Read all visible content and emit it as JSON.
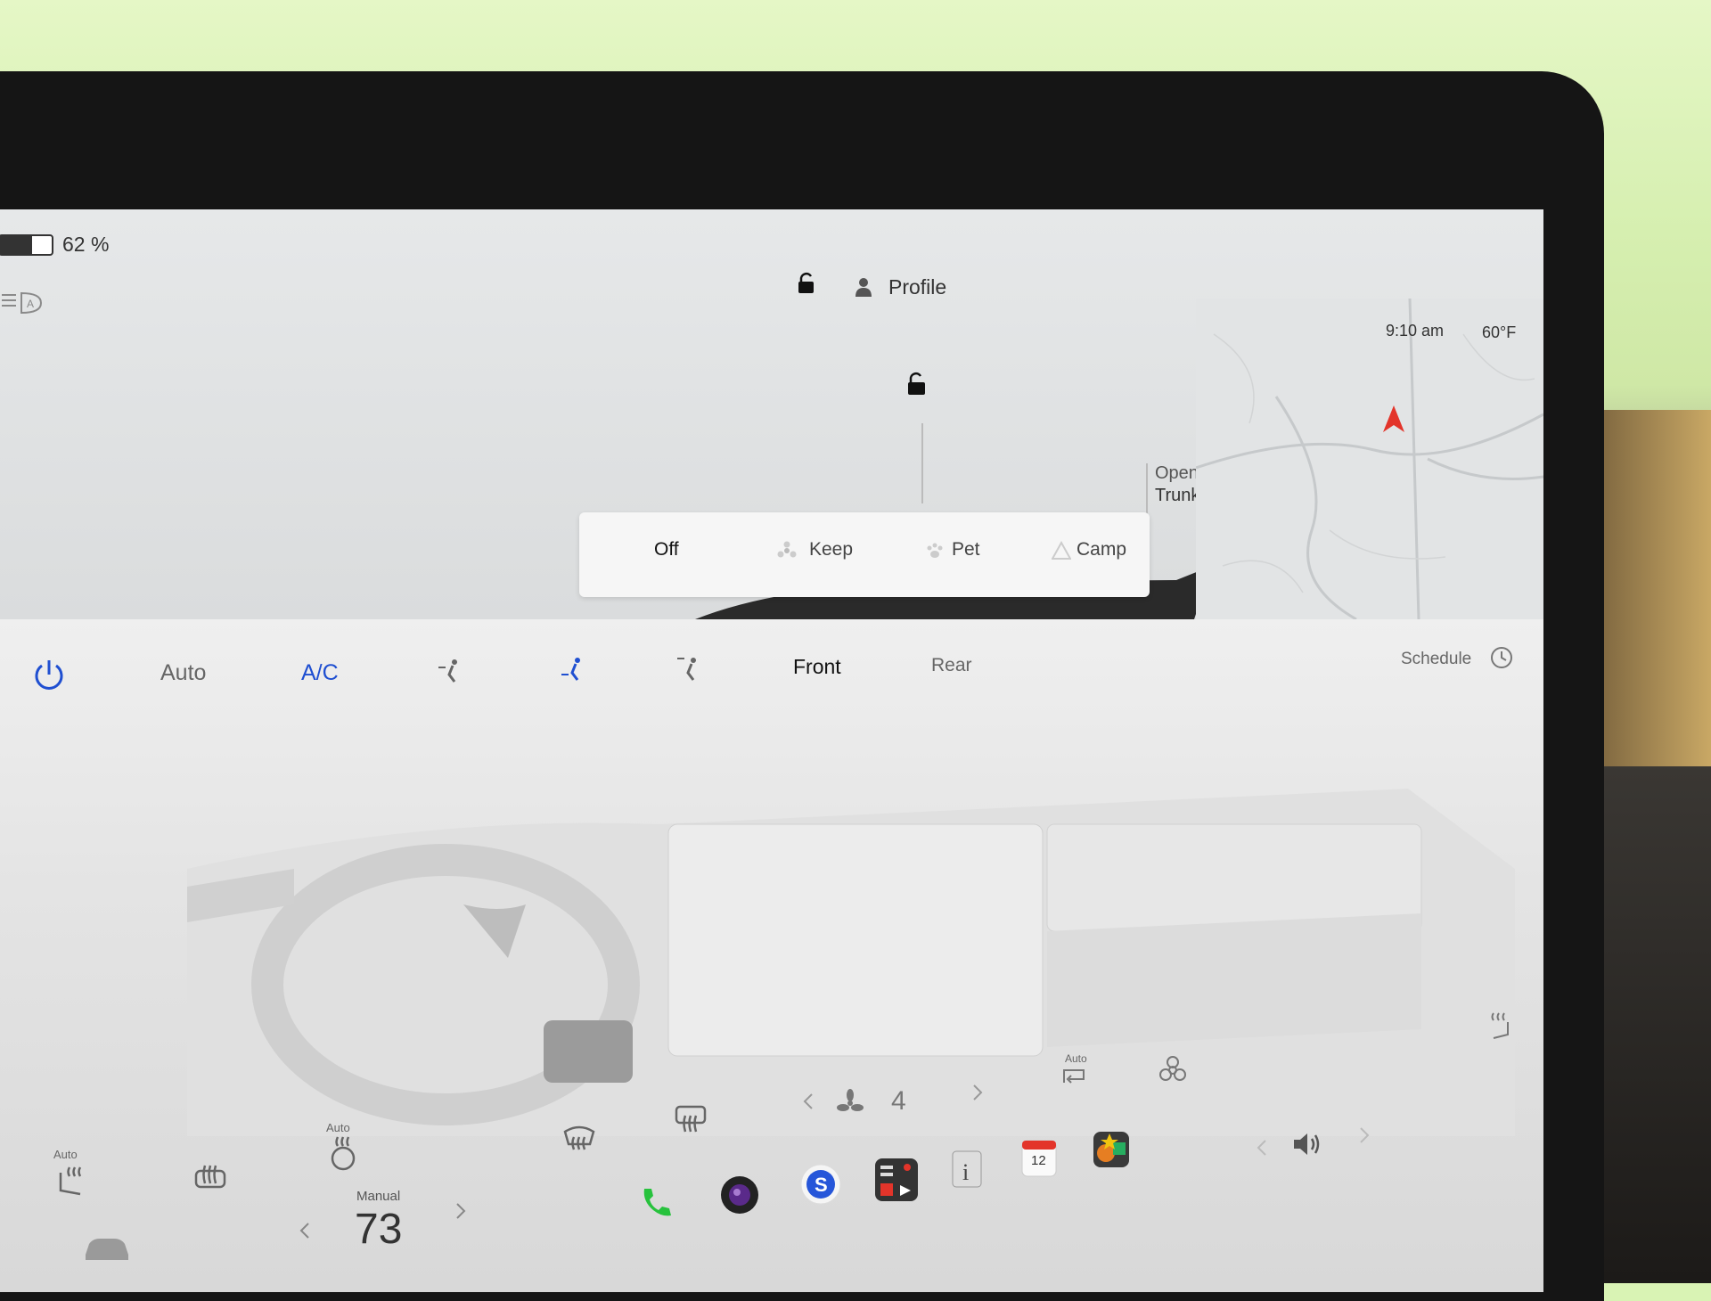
{
  "status": {
    "battery_percent": "62 %",
    "battery_level": 0.62,
    "time": "9:10 am",
    "temperature": "60°F",
    "profile_label": "Profile"
  },
  "car_panel": {
    "open_trunk_line1": "Open",
    "open_trunk_line2": "Trunk",
    "climate_keeper": {
      "options": [
        "Off",
        "Keep",
        "Pet",
        "Camp"
      ],
      "selected": "Off"
    }
  },
  "climate": {
    "auto_label": "Auto",
    "ac_label": "A/C",
    "front_label": "Front",
    "rear_label": "Rear",
    "schedule_label": "Schedule",
    "fan_speed": "4",
    "recirc_auto_label": "Auto",
    "seat_auto_label": "Auto",
    "wheel_auto_label": "Auto"
  },
  "bottom_bar": {
    "temp_mode_label": "Manual",
    "temp_value": "73",
    "calendar_day": "12"
  },
  "colors": {
    "accent_blue": "#1f4fd1",
    "phone_green": "#27c23d",
    "nav_red": "#e3342a"
  }
}
